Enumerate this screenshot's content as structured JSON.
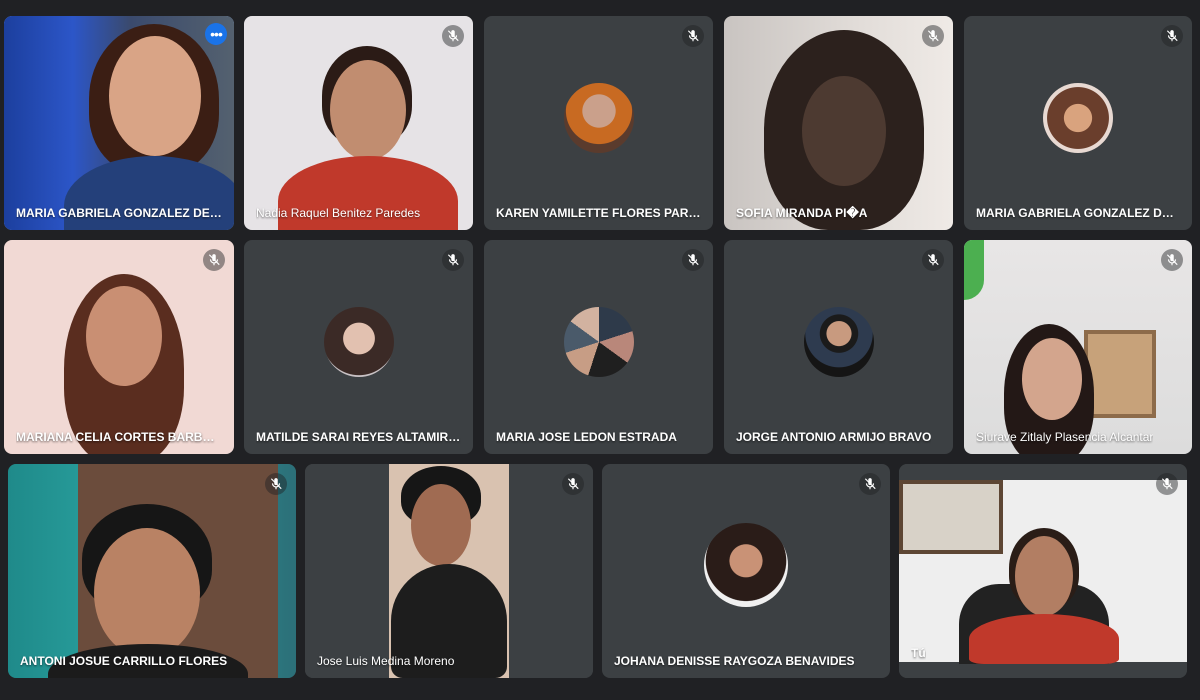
{
  "participants": [
    {
      "name": "MARIA GABRIELA GONZALEZ DE PAB...",
      "active": true
    },
    {
      "name": "Nadia Raquel Benitez Paredes"
    },
    {
      "name": "KAREN YAMILETTE FLORES PARRA"
    },
    {
      "name": "SOFIA MIRANDA PI�A"
    },
    {
      "name": "MARIA GABRIELA GONZALEZ DE PABL..."
    },
    {
      "name": "MARIANA CELIA CORTES BARBOSA"
    },
    {
      "name": "MATILDE SARAI REYES ALTAMIRANO"
    },
    {
      "name": "MARIA JOSE LEDON ESTRADA"
    },
    {
      "name": "JORGE ANTONIO ARMIJO BRAVO"
    },
    {
      "name": "Siurave Zitlaly Plasencia Alcantar"
    },
    {
      "name": "ANTONI JOSUE CARRILLO FLORES"
    },
    {
      "name": "Jose Luis Medina Moreno"
    },
    {
      "name": "JOHANA DENISSE RAYGOZA BENAVIDES"
    },
    {
      "name": "Tú"
    }
  ],
  "icons": {
    "muted": "mic-off-icon",
    "more": "more-options-icon"
  },
  "colors": {
    "background": "#202124",
    "tile": "#3c4043",
    "active_outline": "#8ab4f8",
    "more_button": "#1a73e8"
  }
}
